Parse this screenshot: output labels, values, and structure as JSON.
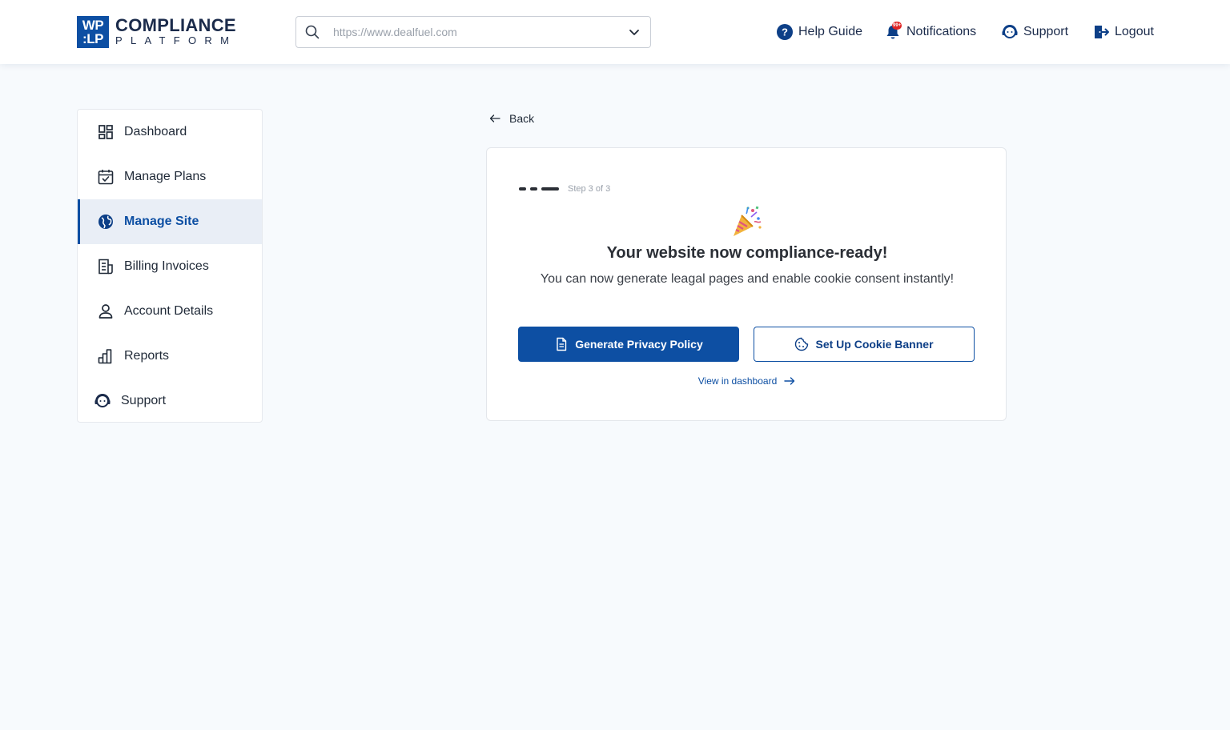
{
  "brand": {
    "mark_line1": "WP",
    "mark_line2": "LP",
    "title": "COMPLIANCE",
    "subtitle": "PLATFORM",
    "color": "#0d4fa3"
  },
  "search": {
    "placeholder": "https://www.dealfuel.com",
    "value": "",
    "icon": "search-icon"
  },
  "topnav": {
    "help": {
      "label": "Help Guide",
      "icon": "help-circle-icon"
    },
    "notifications": {
      "label": "Notifications",
      "icon": "bell-icon",
      "badge": "99+"
    },
    "support": {
      "label": "Support",
      "icon": "support-agent-icon"
    },
    "logout": {
      "label": "Logout",
      "icon": "logout-icon"
    }
  },
  "sidebar": {
    "items": [
      {
        "label": "Dashboard",
        "icon": "dashboard-icon",
        "active": false
      },
      {
        "label": "Manage Plans",
        "icon": "calendar-check-icon",
        "active": false
      },
      {
        "label": "Manage Site",
        "icon": "globe-icon",
        "active": true
      },
      {
        "label": "Billing Invoices",
        "icon": "invoice-icon",
        "active": false
      },
      {
        "label": "Account Details",
        "icon": "user-icon",
        "active": false
      },
      {
        "label": "Reports",
        "icon": "bar-chart-icon",
        "active": false
      },
      {
        "label": "Support",
        "icon": "support-agent-icon",
        "active": false
      }
    ]
  },
  "back": {
    "label": "Back"
  },
  "card": {
    "step_label": "Step 3 of 3",
    "title": "Your website now compliance-ready!",
    "subtitle": "You can now generate leagal pages and enable cookie consent instantly!",
    "primary_button": "Generate Privacy Policy",
    "secondary_button": "Set Up Cookie Banner",
    "link": "View in dashboard"
  }
}
